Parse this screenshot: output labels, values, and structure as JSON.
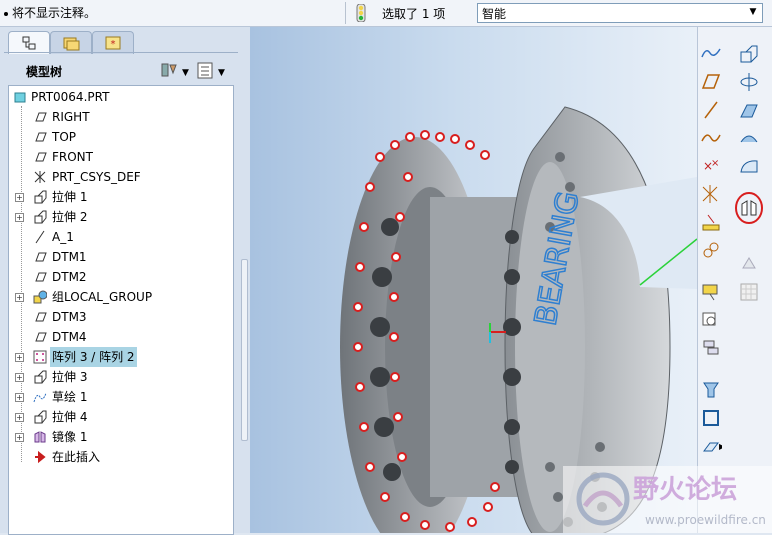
{
  "message": "将不显示注释。",
  "status": {
    "selection": "选取了 1 项",
    "filter": "智能"
  },
  "model_tree": {
    "title": "模型树",
    "items": [
      {
        "label": "PRT0064.PRT",
        "icon": "part-icon",
        "expand": false,
        "root": true
      },
      {
        "label": "RIGHT",
        "icon": "datum-plane-icon"
      },
      {
        "label": "TOP",
        "icon": "datum-plane-icon"
      },
      {
        "label": "FRONT",
        "icon": "datum-plane-icon"
      },
      {
        "label": "PRT_CSYS_DEF",
        "icon": "csys-icon"
      },
      {
        "label": "拉伸 1",
        "icon": "extrude-icon",
        "expand": true
      },
      {
        "label": "拉伸 2",
        "icon": "extrude-icon",
        "expand": true
      },
      {
        "label": "A_1",
        "icon": "datum-axis-icon"
      },
      {
        "label": "DTM1",
        "icon": "datum-plane-icon"
      },
      {
        "label": "DTM2",
        "icon": "datum-plane-icon"
      },
      {
        "label": "组LOCAL_GROUP",
        "icon": "group-icon",
        "expand": true
      },
      {
        "label": "DTM3",
        "icon": "datum-plane-icon"
      },
      {
        "label": "DTM4",
        "icon": "datum-plane-icon"
      },
      {
        "label": "阵列 3 / 阵列 2",
        "icon": "pattern-icon",
        "expand": true,
        "highlight": true
      },
      {
        "label": "拉伸 3",
        "icon": "extrude-icon",
        "expand": true
      },
      {
        "label": "草绘 1",
        "icon": "sketch-icon",
        "expand": true
      },
      {
        "label": "拉伸 4",
        "icon": "extrude-icon",
        "expand": true
      },
      {
        "label": "镜像 1",
        "icon": "mirror-icon",
        "expand": true
      },
      {
        "label": "在此插入",
        "icon": "insert-arrow-icon"
      }
    ]
  },
  "model_text": "BEARING",
  "watermark": {
    "title": "野火论坛",
    "url": "www.proewildfire.cn"
  },
  "colors": {
    "accent": "#2e7fd1",
    "highlight": "#a9d4e4",
    "annotation": "#d81e1e",
    "arrow": "#2bd23a"
  }
}
